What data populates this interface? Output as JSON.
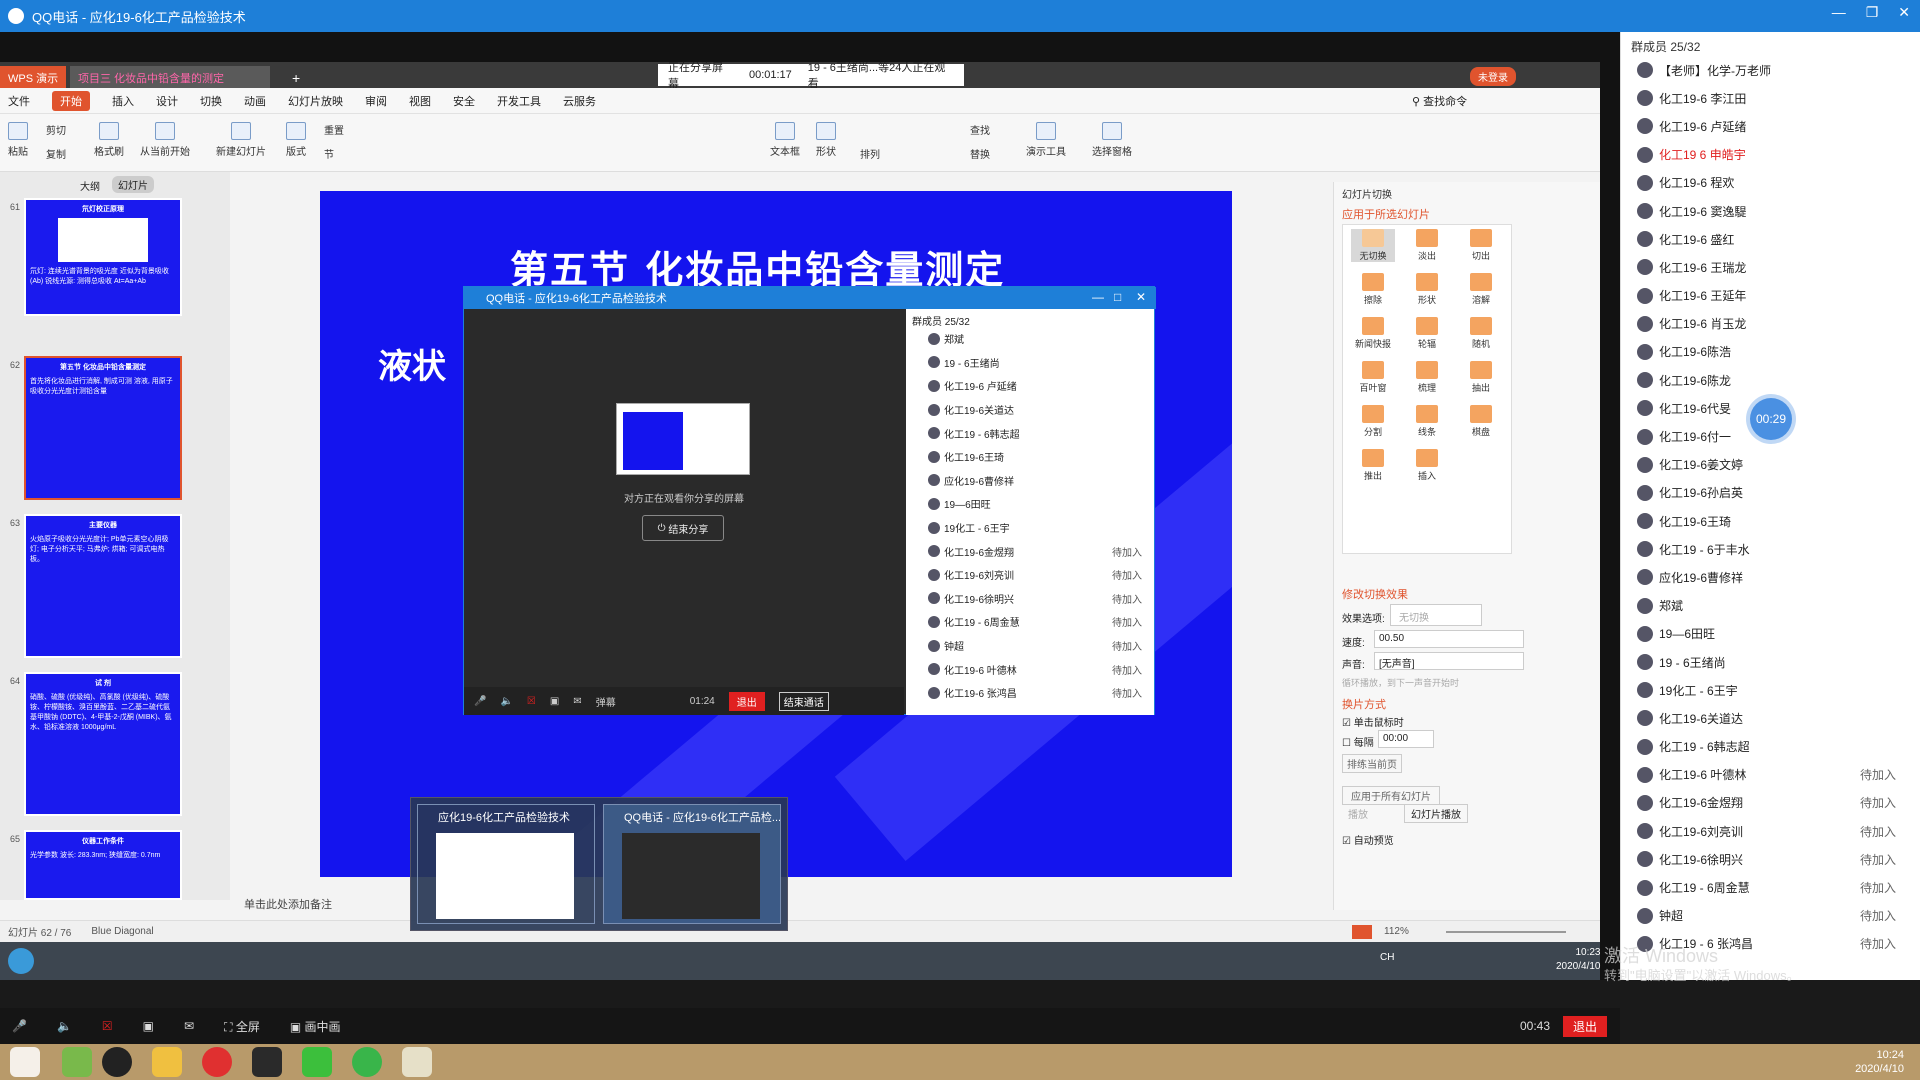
{
  "window": {
    "title": "QQ电话 - 应化19-6化工产品检验技术"
  },
  "members": {
    "header": "群成员 25/32",
    "list": [
      {
        "name": "【老师】化学-万老师",
        "status": ""
      },
      {
        "name": "化工19-6 李江田",
        "status": ""
      },
      {
        "name": "化工19-6 卢延绪",
        "status": ""
      },
      {
        "name": "化工19 6 申皓宇",
        "status": ""
      },
      {
        "name": "化工19-6 程欢",
        "status": ""
      },
      {
        "name": "化工19-6 窦逸騠",
        "status": ""
      },
      {
        "name": "化工19-6 盛红",
        "status": ""
      },
      {
        "name": "化工19-6 王瑞龙",
        "status": ""
      },
      {
        "name": "化工19-6 王延年",
        "status": ""
      },
      {
        "name": "化工19-6 肖玉龙",
        "status": ""
      },
      {
        "name": "化工19-6陈浩",
        "status": ""
      },
      {
        "name": "化工19-6陈龙",
        "status": ""
      },
      {
        "name": "化工19-6代旻",
        "status": ""
      },
      {
        "name": "化工19-6付一",
        "status": ""
      },
      {
        "name": "化工19-6姜文婷",
        "status": ""
      },
      {
        "name": "化工19-6孙启英",
        "status": ""
      },
      {
        "name": "化工19-6王琦",
        "status": ""
      },
      {
        "name": "化工19 - 6于丰水",
        "status": ""
      },
      {
        "name": "应化19-6曹修祥",
        "status": ""
      },
      {
        "name": "郑斌",
        "status": ""
      },
      {
        "name": "19—6田旺",
        "status": ""
      },
      {
        "name": "19 - 6王绪尚",
        "status": ""
      },
      {
        "name": "19化工 - 6王宇",
        "status": ""
      },
      {
        "name": "化工19-6关道达",
        "status": ""
      },
      {
        "name": "化工19 - 6韩志超",
        "status": ""
      },
      {
        "name": "化工19-6 叶德林",
        "status": "待加入"
      },
      {
        "name": "化工19-6金煜翔",
        "status": "待加入"
      },
      {
        "name": "化工19-6刘亮训",
        "status": "待加入"
      },
      {
        "name": "化工19-6徐明兴",
        "status": "待加入"
      },
      {
        "name": "化工19 - 6周金慧",
        "status": "待加入"
      },
      {
        "name": "钟超",
        "status": "待加入"
      },
      {
        "name": "化工19 - 6 张鸿昌",
        "status": "待加入"
      }
    ],
    "bubble_time": "00:29"
  },
  "wps": {
    "tab_app": "WPS 演示",
    "tab_doc": "项目三 化妆品中铅含量的测定",
    "share_status": "正在分享屏幕",
    "share_time": "00:01:17",
    "share_viewers": "19 - 6王绪尚...等24人正在观看",
    "login": "未登录",
    "menus": [
      "文件",
      "开始",
      "插入",
      "设计",
      "切换",
      "动画",
      "幻灯片放映",
      "审阅",
      "视图",
      "安全",
      "开发工具",
      "云服务"
    ],
    "search": "查找命令",
    "ribbon": [
      "粘贴",
      "剪切",
      "复制",
      "格式刷",
      "从当前开始",
      "新建幻灯片",
      "版式",
      "节",
      "重置",
      "文本框",
      "形状",
      "排列",
      "查找",
      "替换",
      "演示工具",
      "选择窗格"
    ],
    "left_tabs": [
      "大纲",
      "幻灯片"
    ],
    "thumbs": [
      {
        "num": "61",
        "title": "氘灯校正原理",
        "body": "氘灯: 连续光谱背景的吸光度 近似为背景吸收 (Ab)  锐线光源: 测得总吸收 At=Aa+Ab"
      },
      {
        "num": "62",
        "title": "第五节 化妆品中铅含量测定",
        "body": "首先将化妆品进行消解, 制成可测 溶液, 用原子吸收分光光度计测铅含量"
      },
      {
        "num": "63",
        "title": "主要仪器",
        "body": "火焰原子吸收分光光度计; Pb单元素空心阴极灯; 电子分析天平; 马弗炉; 烘箱; 可调式电热板。"
      },
      {
        "num": "64",
        "title": "试 剂",
        "body": "硝酸、硫酸 (优级纯)、高氯酸 (优级纯)、硫酸铵、柠檬酸铵、溴百里酚蓝、二乙基二硫代氨基甲酸钠 (DDTC)、4-甲基-2-戊酮 (MIBK)、氨水、铅标准溶液 1000μg/mL"
      },
      {
        "num": "65",
        "title": "仪器工作条件",
        "body": "光学参数 波长: 283.3nm; 狭缝宽度: 0.7nm"
      }
    ],
    "slide_title": "第五节    化妆品中铅含量测定",
    "slide_subtitle": "液状",
    "notes": "单击此处添加备注",
    "status_slide": "幻灯片 62 / 76",
    "status_theme": "Blue Diagonal",
    "zoom": "112%"
  },
  "transition": {
    "panel_title": "幻灯片切换",
    "apply_label": "应用于所选幻灯片",
    "effects": [
      "无切换",
      "淡出",
      "切出",
      "擦除",
      "形状",
      "溶解",
      "新闻快报",
      "轮辐",
      "随机",
      "百叶窗",
      "梳理",
      "抽出",
      "分割",
      "线条",
      "棋盘",
      "推出",
      "插入"
    ],
    "modify_label": "修改切换效果",
    "effect_label": "效果选项:",
    "effect_value": "无切换",
    "speed_label": "速度:",
    "speed_value": "00.50",
    "sound_label": "声音:",
    "sound_value": "[无声音]",
    "loop_label": "循环播放，到下一声音开始时",
    "advance_label": "换片方式",
    "click_label": "单击鼠标时",
    "every_label": "每隔",
    "every_value": "00:00",
    "preview_current": "排练当前页",
    "apply_all": "应用于所有幻灯片",
    "play": "播放",
    "slideshow": "幻灯片播放",
    "auto_preview": "自动预览"
  },
  "popup": {
    "title": "QQ电话 - 应化19-6化工产品检验技术",
    "header": "群成员 25/32",
    "msg": "对方正在观看你分享的屏幕",
    "end_share": "结束分享",
    "time": "01:24",
    "exit": "退出",
    "end_call": "结束通话",
    "danmu": "弹幕",
    "list": [
      {
        "name": "郑斌",
        "status": ""
      },
      {
        "name": "19 - 6王绪尚",
        "status": ""
      },
      {
        "name": "化工19-6 卢延绪",
        "status": ""
      },
      {
        "name": "化工19-6关道达",
        "status": ""
      },
      {
        "name": "化工19 - 6韩志超",
        "status": ""
      },
      {
        "name": "化工19-6王琦",
        "status": ""
      },
      {
        "name": "应化19-6曹修祥",
        "status": ""
      },
      {
        "name": "19—6田旺",
        "status": ""
      },
      {
        "name": "19化工 - 6王宇",
        "status": ""
      },
      {
        "name": "化工19-6金煜翔",
        "status": "待加入"
      },
      {
        "name": "化工19-6刘亮训",
        "status": "待加入"
      },
      {
        "name": "化工19-6徐明兴",
        "status": "待加入"
      },
      {
        "name": "化工19 - 6周金慧",
        "status": "待加入"
      },
      {
        "name": "钟超",
        "status": "待加入"
      },
      {
        "name": "化工19-6 叶德林",
        "status": "待加入"
      },
      {
        "name": "化工19-6 张鸿昌",
        "status": "待加入"
      }
    ]
  },
  "taskbar_preview": {
    "left_label": "应化19-6化工产品检验技术",
    "right_label": "QQ电话 - 应化19-6化工产品检..."
  },
  "inner_clock": {
    "time": "10:23",
    "date": "2020/4/10",
    "lang": "CH"
  },
  "callbar": {
    "fullscreen": "全屏",
    "pip": "画中画",
    "time": "00:43",
    "exit": "退出"
  },
  "watermark": {
    "line1": "激活 Windows",
    "line2": "转到\"电脑设置\"以激活 Windows。"
  },
  "clock": {
    "time": "10:24",
    "date": "2020/4/10"
  },
  "colors": {
    "qq_blue": "#1e7fd8",
    "slide_blue": "#1414ee",
    "wps_accent": "#e0542e",
    "exit_red": "#e02020"
  }
}
